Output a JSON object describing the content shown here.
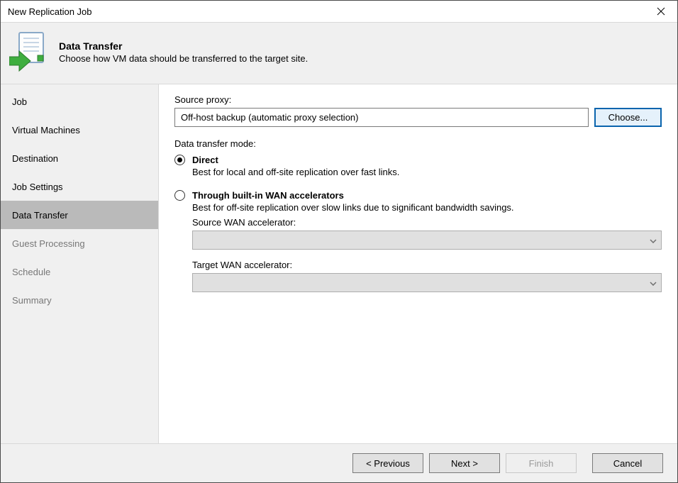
{
  "window": {
    "title": "New Replication Job"
  },
  "header": {
    "title": "Data Transfer",
    "subtitle": "Choose how VM data should be transferred to the target site."
  },
  "sidebar": {
    "steps": [
      {
        "label": "Job",
        "state": "enabled"
      },
      {
        "label": "Virtual Machines",
        "state": "enabled"
      },
      {
        "label": "Destination",
        "state": "enabled"
      },
      {
        "label": "Job Settings",
        "state": "enabled"
      },
      {
        "label": "Data Transfer",
        "state": "selected"
      },
      {
        "label": "Guest Processing",
        "state": "disabled"
      },
      {
        "label": "Schedule",
        "state": "disabled"
      },
      {
        "label": "Summary",
        "state": "disabled"
      }
    ]
  },
  "content": {
    "source_proxy_label": "Source proxy:",
    "source_proxy_value": "Off-host backup (automatic proxy selection)",
    "choose_button": "Choose...",
    "mode_label": "Data transfer mode:",
    "direct": {
      "label": "Direct",
      "desc": "Best for local and off-site replication over fast links.",
      "checked": true
    },
    "wan": {
      "label": "Through built-in WAN accelerators",
      "desc": "Best for off-site replication over slow links due to significant bandwidth savings.",
      "checked": false,
      "source_label": "Source WAN accelerator:",
      "target_label": "Target WAN accelerator:"
    }
  },
  "footer": {
    "previous": "< Previous",
    "next": "Next >",
    "finish": "Finish",
    "cancel": "Cancel"
  }
}
